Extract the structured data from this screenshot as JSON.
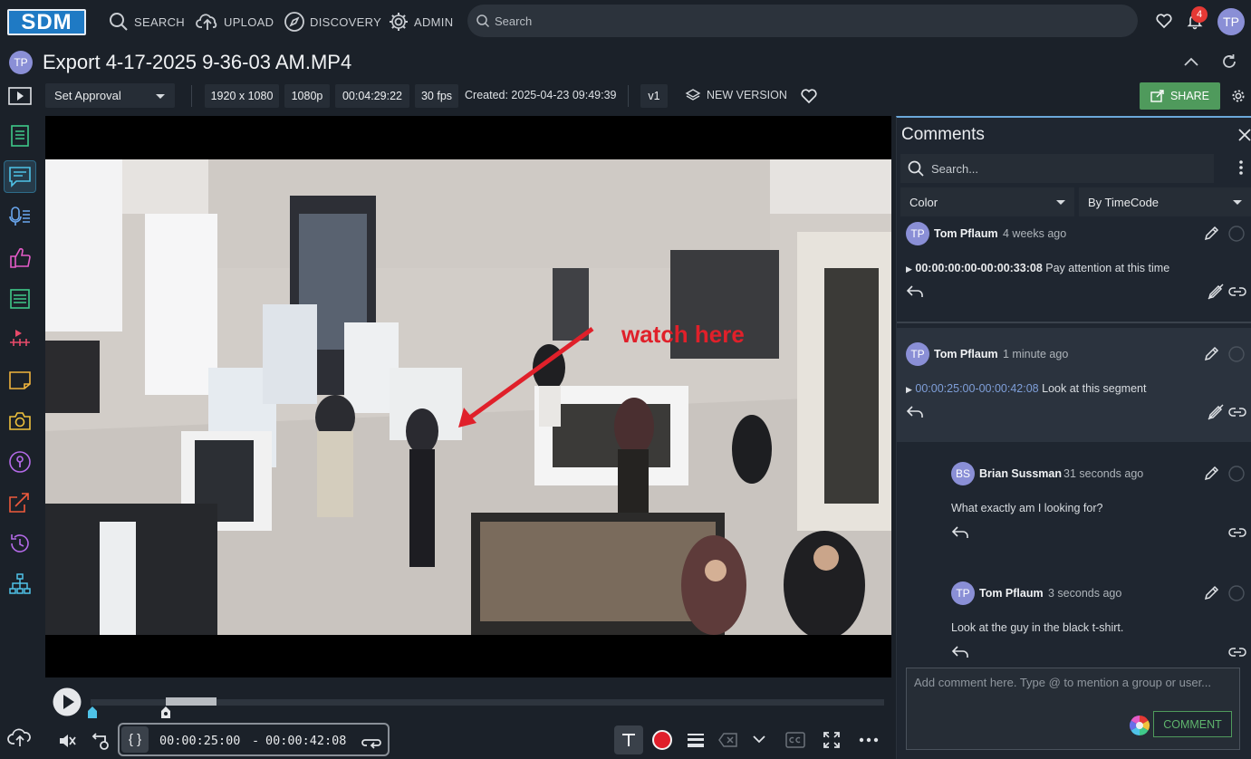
{
  "nav": {
    "logo": "SDM",
    "items": [
      {
        "label": "SEARCH"
      },
      {
        "label": "UPLOAD"
      },
      {
        "label": "DISCOVERY"
      },
      {
        "label": "ADMIN"
      }
    ],
    "search_placeholder": "Search",
    "notification_count": "4",
    "user_initials": "TP"
  },
  "asset": {
    "owner_initials": "TP",
    "title": "Export 4-17-2025 9-36-03 AM.MP4",
    "approval": "Set Approval",
    "resolution": "1920 x 1080",
    "quality": "1080p",
    "duration": "00:04:29:22",
    "fps": "30 fps",
    "created": "Created: 2025-04-23 09:49:39",
    "version": "v1",
    "new_version_label": "NEW VERSION",
    "share_label": "SHARE"
  },
  "video": {
    "annotation_text": "watch here",
    "annotation_color": "#e0202a"
  },
  "player": {
    "progress": 0.09,
    "range_start": "00:00:25:00",
    "range_separator": "-",
    "range_end": "00:00:42:08",
    "range_brackets": "{ }"
  },
  "comments_panel": {
    "title": "Comments",
    "search_placeholder": "Search...",
    "filter_color": "Color",
    "sort": "By TimeCode",
    "items": [
      {
        "initials": "TP",
        "author": "Tom Pflaum",
        "time": "4 weeks ago",
        "timecode": "00:00:00:00-00:00:33:08",
        "text": "Pay attention at this time"
      },
      {
        "initials": "TP",
        "author": "Tom Pflaum",
        "time": "1 minute ago",
        "timecode": "00:00:25:00-00:00:42:08",
        "text": "Look at this segment"
      },
      {
        "initials": "BS",
        "author": "Brian Sussman",
        "time": "31 seconds ago",
        "text": "What exactly am I looking for?"
      },
      {
        "initials": "TP",
        "author": "Tom Pflaum",
        "time": "3 seconds ago",
        "text": "Look at the guy in the black t-shirt."
      }
    ],
    "compose_placeholder": "Add comment here. Type @ to mention a group or user...",
    "comment_button": "COMMENT"
  },
  "colors": {
    "accent": "#4f9a5c",
    "active_cyan": "#4fc3e8",
    "avatar": "#8a8fd6"
  }
}
